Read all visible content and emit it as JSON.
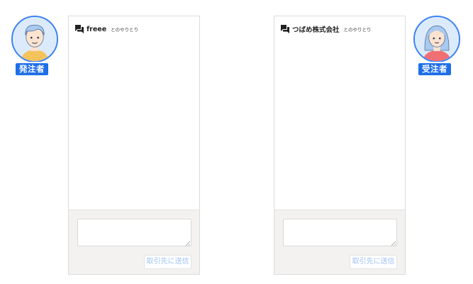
{
  "participants": {
    "left": {
      "role": "発注者",
      "avatar_icon": "male-user-avatar-icon"
    },
    "right": {
      "role": "受注者",
      "avatar_icon": "female-user-avatar-icon"
    }
  },
  "panels": [
    {
      "partner_name": "freee",
      "header_suffix": "とのやりとり",
      "header_icon": "chat-bubble-icon",
      "input_value": "",
      "send_label": "取引先に送信"
    },
    {
      "partner_name": "つばめ株式会社",
      "header_suffix": "とのやりとり",
      "header_icon": "chat-bubble-icon",
      "input_value": "",
      "send_label": "取引先に送信"
    }
  ],
  "colors": {
    "accent": "#1f6fe8",
    "send_disabled_text": "#9fc3f5",
    "footer_bg": "#f3f2f1"
  }
}
